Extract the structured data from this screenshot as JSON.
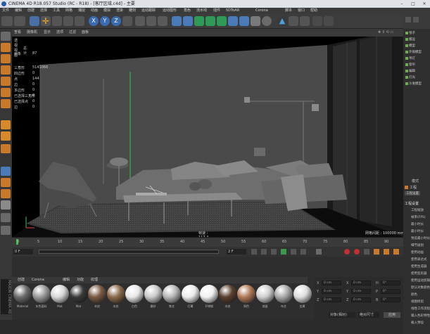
{
  "window": {
    "title": "CINEMA 4D R18.057 Studio (RC - R18) - [客厅区域.c4d] - 主要"
  },
  "menu": [
    "文件",
    "编辑",
    "创建",
    "选择",
    "工具",
    "网格",
    "捕捉",
    "动画",
    "模拟",
    "渲染",
    "雕刻",
    "运动跟踪",
    "运动图形",
    "角色",
    "流水线",
    "插件",
    "5DToAR",
    "Corona",
    "脚本",
    "窗口",
    "帮助"
  ],
  "viewport": {
    "menu": [
      "查看",
      "摄像机",
      "显示",
      "选项",
      "过滤",
      "面板"
    ],
    "name": "透视视图",
    "stats_header": "总计",
    "stats": [
      {
        "label": "对象",
        "value": "87"
      },
      {
        "label": "三角形",
        "value": "5141066"
      },
      {
        "label": "四边形",
        "value": "0"
      },
      {
        "label": "点",
        "value": "144"
      },
      {
        "label": "边",
        "value": "0"
      },
      {
        "label": "多边形",
        "value": "0"
      },
      {
        "label": "已选择三角形",
        "value": "0"
      },
      {
        "label": "已选择点",
        "value": "0"
      },
      {
        "label": "边",
        "value": "0"
      }
    ],
    "fps_label": "帧速 : 117.4",
    "grid_label": "网格间距 : 100000 mm"
  },
  "objects": {
    "items": [
      "毯子",
      "搬运",
      "模型",
      "外观模型",
      "吊灯",
      "窗帘",
      "编辑",
      "灯光",
      "沙发模型"
    ]
  },
  "attributes": {
    "mode": "模式",
    "tabs": [
      "工程",
      "工程设置"
    ],
    "section": "工程设置",
    "rows": [
      "工程缩放",
      "帧率(FPS)",
      "最小时长",
      "最小时长",
      "预览最小时长",
      "细节级别",
      "使用动画",
      "使用表达式",
      "使用生成器",
      "使用变形器",
      "使用运动剪辑",
      "默认对象颜色",
      "颜色",
      "视图修剪",
      "线性工作流程",
      "输入色彩特性",
      "载入预设"
    ]
  },
  "timeline": {
    "ticks": [
      "0",
      "5",
      "10",
      "15",
      "20",
      "25",
      "30",
      "35",
      "40",
      "45",
      "50",
      "55",
      "60",
      "65",
      "70",
      "75",
      "80",
      "85",
      "90"
    ],
    "current": "0 F",
    "start": "0 F",
    "end": "90 F",
    "max": "2 F",
    "frame_box": "0 F"
  },
  "materials": {
    "tabs": [
      "创建",
      "Corona",
      "编辑",
      "功能",
      "纹理"
    ],
    "items": [
      {
        "name": "Material",
        "color": "#6c6c6c"
      },
      {
        "name": "灰色面料",
        "color": "#9a9a9a"
      },
      {
        "name": "Mat",
        "color": "#d8d8d8"
      },
      {
        "name": "Mat",
        "color": "#3a3a3a"
      },
      {
        "name": "木纹",
        "color": "#7a5a44"
      },
      {
        "name": "木纹",
        "color": "#8a6a4a"
      },
      {
        "name": "白色",
        "color": "#e8e8e8"
      },
      {
        "name": "磨砂",
        "color": "#c9c9c9"
      },
      {
        "name": "铁艺",
        "color": "#b8b8b8"
      },
      {
        "name": "灯罩",
        "color": "#ececec"
      },
      {
        "name": "不锈钢",
        "color": "#f0f0f0"
      },
      {
        "name": "木纹",
        "color": "#5a4030"
      },
      {
        "name": "铜色",
        "color": "#b07a5a"
      },
      {
        "name": "地面",
        "color": "#cfcfcf"
      },
      {
        "name": "布艺",
        "color": "#a9a9a9"
      },
      {
        "name": "金属",
        "color": "#dedede"
      }
    ]
  },
  "coords": {
    "rows": [
      {
        "a": "X",
        "av": "0 cm",
        "b": "X",
        "bv": "0 cm",
        "c": "H",
        "cv": "0°"
      },
      {
        "a": "Y",
        "av": "0 cm",
        "b": "Y",
        "bv": "0 cm",
        "c": "P",
        "cv": "0°"
      },
      {
        "a": "Z",
        "av": "0 cm",
        "b": "Z",
        "bv": "0 cm",
        "c": "B",
        "cv": "0°"
      }
    ],
    "mode": "对象(相对)",
    "size_mode": "绝对尺寸",
    "apply": "应用"
  }
}
